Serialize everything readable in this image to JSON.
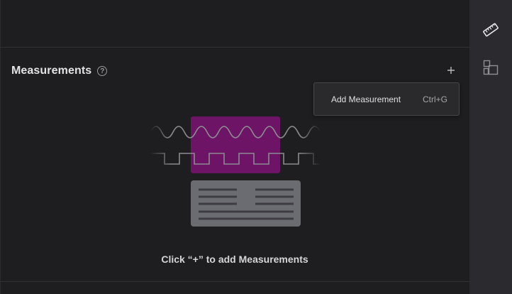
{
  "panel": {
    "title": "Measurements",
    "help_icon": "question-circle-icon",
    "add_icon": "plus-icon",
    "empty_message": "Click “+” to add Measurements"
  },
  "popup": {
    "items": [
      {
        "label": "Add Measurement",
        "shortcut": "Ctrl+G"
      }
    ]
  },
  "sidebar": {
    "items": [
      {
        "icon": "ruler-icon",
        "active": true
      },
      {
        "icon": "widgets-icon",
        "active": false
      }
    ]
  },
  "colors": {
    "accent": "#6e1466",
    "background": "#1e1e20",
    "sidebar": "#2b2b2f",
    "illustration_gray": "#6b6b72"
  }
}
